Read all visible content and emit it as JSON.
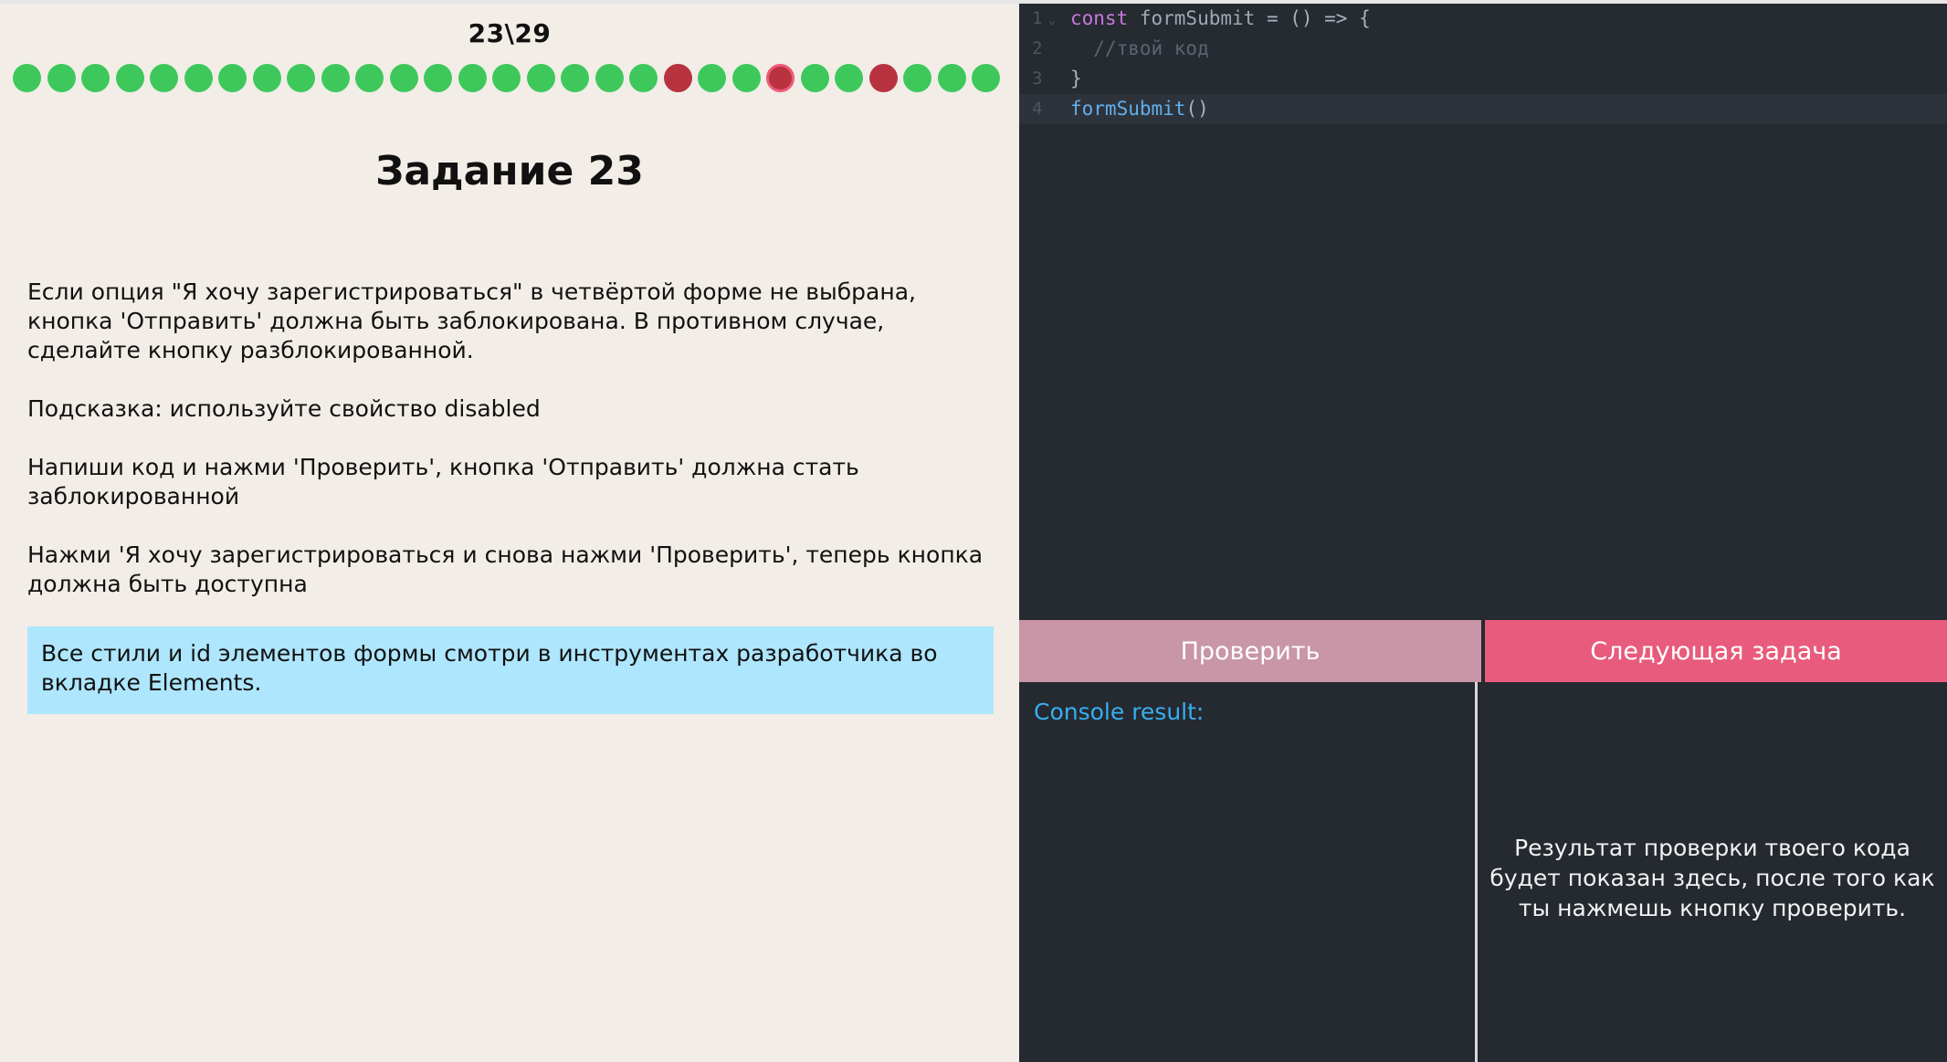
{
  "progress": {
    "counter": "23\\29",
    "current": 23,
    "total": 29,
    "dots": [
      "done",
      "done",
      "done",
      "done",
      "done",
      "done",
      "done",
      "done",
      "done",
      "done",
      "done",
      "done",
      "done",
      "done",
      "done",
      "done",
      "done",
      "done",
      "done",
      "failed",
      "done",
      "done",
      "current",
      "done",
      "done",
      "failed",
      "done",
      "done",
      "done"
    ],
    "colors": {
      "done": "#3ec85c",
      "failed": "#b83240",
      "current_border": "#ee5a79"
    }
  },
  "task": {
    "title": "Задание 23",
    "paragraphs": [
      "Если опция \"Я хочу зарегистрироваться\" в четвёртой форме не выбрана, кнопка 'Отправить' должна быть заблокирована. В противном случае, сделайте кнопку разблокированной.",
      "Подсказка: используйте свойство disabled",
      "Напиши код и нажми 'Проверить', кнопка 'Отправить' должна стать заблокированной",
      "Нажми 'Я хочу зарегистрироваться и снова нажми 'Проверить', теперь кнопка должна быть доступна"
    ],
    "note": "Все стили и id элементов формы смотри в инструментах разработчика во вкладке Elements."
  },
  "editor": {
    "line_numbers": [
      "1",
      "2",
      "3",
      "4"
    ],
    "fold_marker": "⌄",
    "lines": [
      {
        "tokens": [
          {
            "t": "const",
            "c": "kw"
          },
          {
            "t": " formSubmit",
            "c": "fn"
          },
          {
            "t": " = () => {",
            "c": ""
          }
        ]
      },
      {
        "tokens": [
          {
            "t": "  //твой код",
            "c": "cm"
          }
        ]
      },
      {
        "tokens": [
          {
            "t": "}",
            "c": ""
          }
        ]
      },
      {
        "tokens": [
          {
            "t": "formSubmit",
            "c": "call"
          },
          {
            "t": "()",
            "c": ""
          }
        ]
      }
    ]
  },
  "buttons": {
    "check": "Проверить",
    "next": "Следующая задача"
  },
  "console": {
    "label": "Console result:"
  },
  "result": {
    "placeholder": "Результат проверки твоего кода будет показан здесь, после того как ты нажмешь кнопку проверить."
  }
}
